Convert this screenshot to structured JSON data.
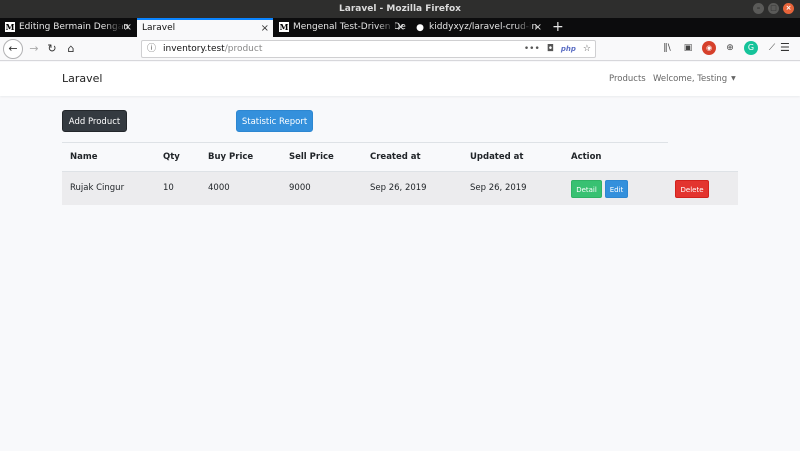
{
  "window": {
    "title": "Laravel - Mozilla Firefox"
  },
  "tabs": [
    {
      "label": "Editing Bermain Dengan",
      "favicon": "M"
    },
    {
      "label": "Laravel",
      "favicon": ""
    },
    {
      "label": "Mengenal Test-Driven De",
      "favicon": "M"
    },
    {
      "label": "kiddyxyz/laravel-crud-in",
      "favicon": "GH"
    }
  ],
  "url": {
    "host": "inventory.test",
    "path": "/product"
  },
  "app": {
    "brand": "Laravel",
    "nav_products": "Products",
    "nav_welcome": "Welcome, Testing"
  },
  "actions": {
    "add_product": "Add Product",
    "statistic_report": "Statistic Report"
  },
  "table": {
    "headers": [
      "Name",
      "Qty",
      "Buy Price",
      "Sell Price",
      "Created at",
      "Updated at",
      "Action"
    ],
    "rows": [
      {
        "name": "Rujak Cingur",
        "qty": "10",
        "buy_price": "4000",
        "sell_price": "9000",
        "created_at": "Sep 26, 2019",
        "updated_at": "Sep 26, 2019",
        "detail": "Detail",
        "edit": "Edit",
        "delete": "Delete"
      }
    ]
  },
  "colors": {
    "primary": "#3490dc",
    "success": "#38c172",
    "danger": "#e3342f",
    "dark": "#343a40"
  }
}
